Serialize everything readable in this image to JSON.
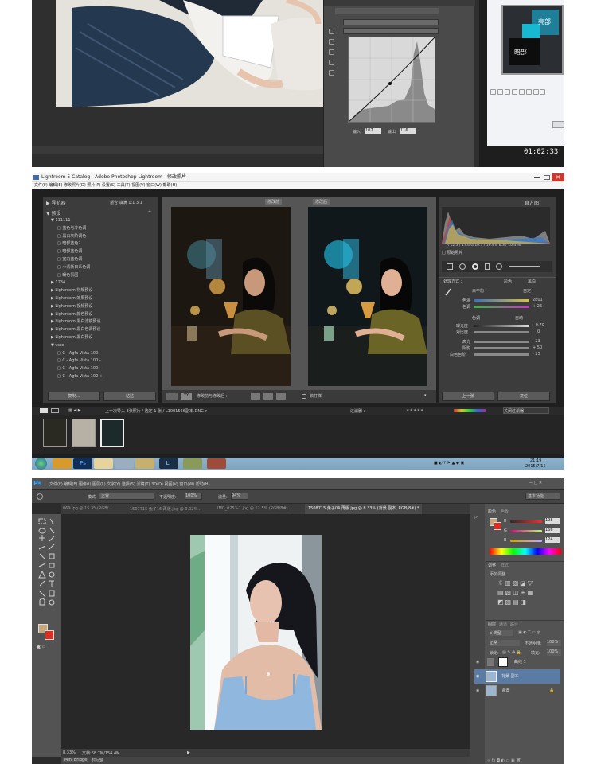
{
  "screenshot1": {
    "timestamp": "01:02:33",
    "curves_input_label": "输入:",
    "curves_input_value": "107",
    "curves_output_label": "输出:",
    "curves_output_value": "116",
    "dialog_label_light": "亮部",
    "dialog_label_dark": "暗部"
  },
  "lightroom": {
    "window_title": "Lightroom 5 Catalog - Adobe Photoshop Lightroom - 修改照片",
    "menu": [
      "文件(F)",
      "编辑(E)",
      "修改照片(D)",
      "照片(P)",
      "设置(S)",
      "工具(T)",
      "视图(V)",
      "窗口(W)",
      "帮助(H)"
    ],
    "navigator_label": "导航器",
    "navigator_zoom": [
      "适合",
      "填满",
      "1:1",
      "3:1"
    ],
    "presets_label": "预设",
    "preset_tree": [
      "▼ 111111",
      "□ 蓝色与冷色调",
      "□ 黑白灰阶调色",
      "□ 暗部蓝色2",
      "□ 暗部蓝色调",
      "□ 室内蓝色调",
      "□ 小清新日系色调",
      "□ 暖色氛围",
      "▶ 1234",
      "▶ Lightroom 常规预设",
      "▶ Lightroom 效果预设",
      "▶ Lightroom 视频预设",
      "▶ Lightroom 颜色预设",
      "▶ Lightroom 黑白滤镜预设",
      "▶ Lightroom 黑白色调预设",
      "▶ Lightroom 黑白预设",
      "▼ vsco",
      "□ C - Agfa Vista 100",
      "□ C - Agfa Vista 100 -",
      "□ C - Agfa Vista 100 --",
      "□ C - Agfa Vista 100 +"
    ],
    "copy_button": "复制...",
    "paste_button": "粘贴",
    "before_label": "修改前",
    "after_label": "修改后",
    "sync_text": "修改前与修改后 :",
    "softproof_label": "软打样",
    "histogram_label": "直方图",
    "histogram_values": "R 12.3 / 17.4  G 10.3 / 16.9  B 6.3 / 10.4 %",
    "original_photo_label": "原始照片",
    "basic_label": "处理方式 :",
    "color_label": "彩色",
    "bw_label": "黑白",
    "wb_label": "白平衡 :",
    "wb_value": "自定 :",
    "temp_label": "色温",
    "temp_value": "2801",
    "tint_label": "色调",
    "tint_value": "+ 26",
    "tone_label": "色调",
    "auto_label": "自动",
    "exposure_label": "曝光度",
    "exposure_value": "+ 0.70",
    "contrast_label": "对比度",
    "contrast_value": "0",
    "highlights_label": "高光",
    "highlights_value": "- 23",
    "shadows_label": "阴影",
    "shadows_value": "+ 50",
    "whites_label": "白色色阶",
    "whites_value": "- 25",
    "prev_button": "上一张",
    "reset_button": "复位",
    "filmstrip_info": "上一次导入    3张照片 / 选定 1 张 / L1001566副本.DNG ▾",
    "filter_label": "过滤器 :",
    "filter_value": "关闭过滤器",
    "taskbar_time": "21:19",
    "taskbar_date": "2015/7/15",
    "taskbar_ps": "Ps",
    "taskbar_lr": "Lr"
  },
  "photoshop": {
    "logo": "Ps",
    "menu": [
      "文件(F)",
      "编辑(E)",
      "图像(I)",
      "图层(L)",
      "文字(Y)",
      "选择(S)",
      "滤镜(T)",
      "3D(D)",
      "视图(V)",
      "窗口(W)",
      "帮助(H)"
    ],
    "workspace": "基本功能",
    "mode_label": "模式:",
    "mode_value": "正常",
    "opacity_label": "不透明度:",
    "opacity_value": "100%",
    "flow_label": "流量:",
    "flow_value": "94%",
    "tabs": [
      "069.jpg @ 15.3%(RGB/...",
      "1507715 兔子16 再版.jpg @ 9.02%...",
      "IMG_0253-1.jpg @ 12.5% (RGB/8#)...",
      "1508715 兔子04 再版.jpg @ 8.33% (背景 副本, RGB/8#) *"
    ],
    "zoom": "8.33%",
    "doc_size": "文档:68.7M/154.4M",
    "bottom_tabs": [
      "Mini Bridge",
      "时间轴"
    ],
    "color_tab": "颜色",
    "swatches_tab": "色板",
    "r_label": "R",
    "r_value": "198",
    "g_label": "G",
    "g_value": "166",
    "b_label": "B",
    "b_value": "124",
    "adjust_tab": "调整",
    "styles_tab": "样式",
    "add_adjust": "添加调整",
    "layers_tab": "图层",
    "channels_tab": "通道",
    "paths_tab": "路径",
    "kind_label": "ρ 类型",
    "blend_mode": "正常",
    "layer_opacity_label": "不透明度:",
    "layer_opacity": "100%",
    "lock_label": "锁定:",
    "fill_label": "填充:",
    "fill_value": "100%",
    "layers": [
      "曲线 1",
      "背景 副本",
      "背景"
    ]
  },
  "colors": {
    "lr_bg": "#1f1f1f",
    "lr_panel": "#3c3c3c",
    "ps_panel": "#535353",
    "fg_swatch": "#c6a67c",
    "bg_swatch": "#e12b1c",
    "selected_layer": "#5a7ba3"
  }
}
